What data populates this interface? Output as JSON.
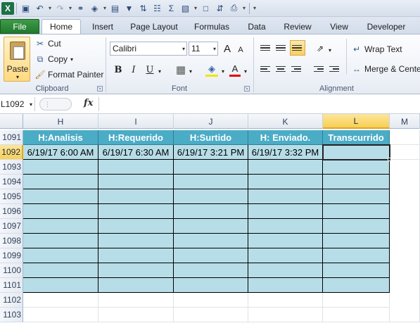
{
  "app": {
    "logo": "X"
  },
  "qat": {
    "icons": [
      "save-icon",
      "undo-icon",
      "redo-icon",
      "binoculars-icon",
      "fill-icon",
      "form-icon",
      "filter-icon",
      "sort-icon",
      "find-icon",
      "sum-icon",
      "paste-icon",
      "print-preview-icon",
      "sort-az-icon",
      "print-icon",
      "customize-icon"
    ]
  },
  "tabs": [
    {
      "label": "File"
    },
    {
      "label": "Home"
    },
    {
      "label": "Insert"
    },
    {
      "label": "Page Layout"
    },
    {
      "label": "Formulas"
    },
    {
      "label": "Data"
    },
    {
      "label": "Review"
    },
    {
      "label": "View"
    },
    {
      "label": "Developer"
    }
  ],
  "clipboard": {
    "paste": "Paste",
    "cut": "Cut",
    "copy": "Copy",
    "format_painter": "Format Painter",
    "label": "Clipboard"
  },
  "font": {
    "name": "Calibri",
    "size": "11",
    "bold": "B",
    "italic": "I",
    "underline": "U",
    "grow": "A",
    "shrink": "A",
    "color": "A",
    "label": "Font"
  },
  "alignment": {
    "wrap": "Wrap Text",
    "merge": "Merge & Center",
    "label": "Alignment"
  },
  "formula_bar": {
    "name_box": "L1092",
    "fx": "fx",
    "value": ""
  },
  "columns": [
    "H",
    "I",
    "J",
    "K",
    "L",
    "M"
  ],
  "selected_column": "L",
  "rows": [
    "1091",
    "1092",
    "1093",
    "1094",
    "1095",
    "1096",
    "1097",
    "1098",
    "1099",
    "1100",
    "1101",
    "1102",
    "1103"
  ],
  "selected_row": "1092",
  "table": {
    "headers": [
      "H:Analisis",
      "H:Requerido",
      "H:Surtido",
      "H: Enviado.",
      "Transcurrido"
    ],
    "data_row": [
      "6/19/17 6:00 AM",
      "6/19/17 6:30 AM",
      "6/19/17 3:21 PM",
      "6/19/17 3:32 PM",
      ""
    ]
  },
  "colors": {
    "header_fill": "#4BACC6",
    "body_fill": "#B7DEE8",
    "file_tab": "#1F7A2E"
  }
}
